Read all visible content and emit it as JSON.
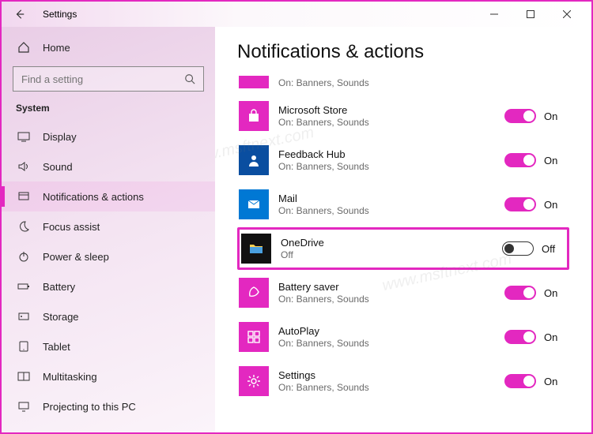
{
  "window": {
    "title": "Settings"
  },
  "sidebar": {
    "home": "Home",
    "search_placeholder": "Find a setting",
    "section": "System",
    "items": [
      {
        "label": "Display"
      },
      {
        "label": "Sound"
      },
      {
        "label": "Notifications & actions"
      },
      {
        "label": "Focus assist"
      },
      {
        "label": "Power & sleep"
      },
      {
        "label": "Battery"
      },
      {
        "label": "Storage"
      },
      {
        "label": "Tablet"
      },
      {
        "label": "Multitasking"
      },
      {
        "label": "Projecting to this PC"
      }
    ]
  },
  "main": {
    "heading": "Notifications & actions",
    "apps": [
      {
        "name": "",
        "sub": "On: Banners, Sounds",
        "state": "On",
        "icon_bg": "ic-pink",
        "svg": ""
      },
      {
        "name": "Microsoft Store",
        "sub": "On: Banners, Sounds",
        "state": "On",
        "icon_bg": "ic-pink",
        "svg": "shopping-bag"
      },
      {
        "name": "Feedback Hub",
        "sub": "On: Banners, Sounds",
        "state": "On",
        "icon_bg": "ic-blue-dk",
        "svg": "person"
      },
      {
        "name": "Mail",
        "sub": "On: Banners, Sounds",
        "state": "On",
        "icon_bg": "ic-blue",
        "svg": "mail"
      },
      {
        "name": "OneDrive",
        "sub": "Off",
        "state": "Off",
        "icon_bg": "ic-black",
        "svg": "folder",
        "highlighted": true
      },
      {
        "name": "Battery saver",
        "sub": "On: Banners, Sounds",
        "state": "On",
        "icon_bg": "ic-pink",
        "svg": "leaf"
      },
      {
        "name": "AutoPlay",
        "sub": "On: Banners, Sounds",
        "state": "On",
        "icon_bg": "ic-pink",
        "svg": "grid"
      },
      {
        "name": "Settings",
        "sub": "On: Banners, Sounds",
        "state": "On",
        "icon_bg": "ic-pink",
        "svg": "gear"
      }
    ]
  },
  "watermark": "www.msftnext.com"
}
